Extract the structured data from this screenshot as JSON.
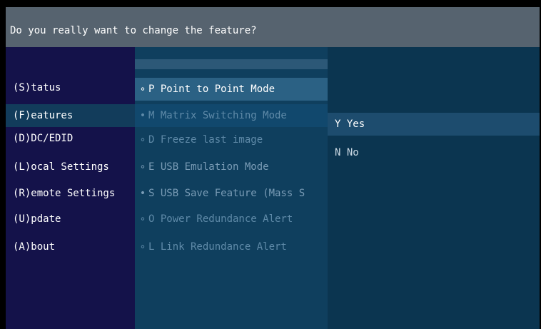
{
  "title": "Do you really want to change the feature?",
  "menu": {
    "items": [
      {
        "label": "(S)tatus"
      },
      {
        "label": "(F)eatures"
      },
      {
        "label": "(D)DC/EDID"
      },
      {
        "label": "(L)ocal  Settings"
      },
      {
        "label": "(R)emote Settings"
      },
      {
        "label": "(U)pdate"
      },
      {
        "label": "(A)bout"
      }
    ],
    "selected_index": 1
  },
  "features": {
    "items": [
      {
        "bullet": "∘",
        "label": "P Point to Point Mode"
      },
      {
        "bullet": "•",
        "label": "M Matrix Switching Mode"
      },
      {
        "bullet": "∘",
        "label": "D Freeze last image"
      },
      {
        "bullet": "∘",
        "label": "E USB Emulation Mode"
      },
      {
        "bullet": "•",
        "label": "S USB Save Feature (Mass S"
      },
      {
        "bullet": "∘",
        "label": "O Power Redundance Alert"
      },
      {
        "bullet": "∘",
        "label": "L Link Redundance Alert"
      }
    ],
    "highlight_index": 0,
    "selected_index": 1
  },
  "confirm": {
    "items": [
      {
        "label": "Y Yes"
      },
      {
        "label": "N No"
      }
    ],
    "highlight_index": 0
  },
  "colors": {
    "title_bar": "#56636f",
    "menu_bg": "#14124a",
    "features_bg": "#0f3f5e",
    "highlight": "#2b6184",
    "background": "#0b3550"
  }
}
